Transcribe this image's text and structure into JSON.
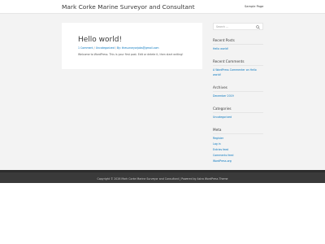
{
  "header": {
    "site_title": "Mark Corke Marine Surveyor and Consultant",
    "nav": [
      {
        "label": "Sample Page"
      }
    ]
  },
  "post": {
    "title": "Hello world!",
    "meta": {
      "comments": "1 Comment",
      "category": "Uncategorized",
      "author": "By: thesurveyorjobs@gmail.com"
    },
    "excerpt": "Welcome to WordPress. This is your first post. Edit or delete it, then start writing!"
  },
  "sidebar": {
    "search": {
      "placeholder": "Search ...",
      "icon": "search-icon"
    },
    "recent_posts": {
      "title": "Recent Posts",
      "items": [
        "Hello world!"
      ]
    },
    "recent_comments": {
      "title": "Recent Comments",
      "line1": "A WordPress Commenter on Hello",
      "line2": "world!"
    },
    "archives": {
      "title": "Archives",
      "items": [
        "December 2019"
      ]
    },
    "categories": {
      "title": "Categories",
      "items": [
        "Uncategorized"
      ]
    },
    "meta": {
      "title": "Meta",
      "items": [
        "Register",
        "Log in",
        "Entries feed",
        "Comments feed",
        "WordPress.org"
      ]
    }
  },
  "footer": {
    "text": "Copyright © 2026 Mark Corke Marine Surveyor and Consultant | Powered by Astra WordPress Theme"
  },
  "colors": {
    "link": "#0274be",
    "background": "#f3f3f3",
    "footer": "#3a3a3a"
  }
}
